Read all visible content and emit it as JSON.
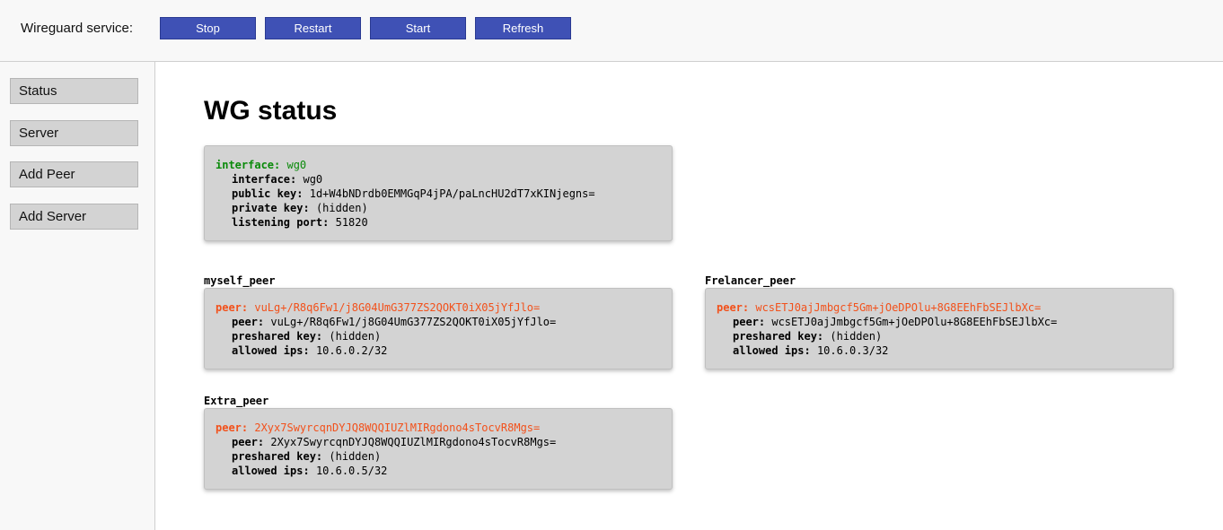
{
  "topbar": {
    "service_label": "Wireguard service:",
    "buttons": {
      "stop": "Stop",
      "restart": "Restart",
      "start": "Start",
      "refresh": "Refresh"
    }
  },
  "sidebar": {
    "items": [
      {
        "label": "Status"
      },
      {
        "label": "Server"
      },
      {
        "label": "Add Peer"
      },
      {
        "label": "Add Server"
      }
    ]
  },
  "main": {
    "title": "WG status",
    "interface": {
      "head_key": "interface:",
      "head_value": "wg0",
      "rows": [
        {
          "key": "interface:",
          "value": "wg0"
        },
        {
          "key": "public key:",
          "value": "1d+W4bNDrdb0EMMGqP4jPA/paLncHU2dT7xKINjegns="
        },
        {
          "key": "private key:",
          "value": "(hidden)"
        },
        {
          "key": "listening port:",
          "value": "51820"
        }
      ]
    },
    "peers": [
      {
        "name": "myself_peer",
        "head_key": "peer:",
        "head_value": "vuLg+/R8q6Fw1/j8G04UmG377ZS2QOKT0iX05jYfJlo=",
        "rows": [
          {
            "key": "peer:",
            "value": "vuLg+/R8q6Fw1/j8G04UmG377ZS2QOKT0iX05jYfJlo="
          },
          {
            "key": "preshared key:",
            "value": "(hidden)"
          },
          {
            "key": "allowed ips:",
            "value": "10.6.0.2/32"
          }
        ]
      },
      {
        "name": "Frelancer_peer",
        "head_key": "peer:",
        "head_value": "wcsETJ0ajJmbgcf5Gm+jOeDPOlu+8G8EEhFbSEJlbXc=",
        "rows": [
          {
            "key": "peer:",
            "value": "wcsETJ0ajJmbgcf5Gm+jOeDPOlu+8G8EEhFbSEJlbXc="
          },
          {
            "key": "preshared key:",
            "value": "(hidden)"
          },
          {
            "key": "allowed ips:",
            "value": "10.6.0.3/32"
          }
        ]
      },
      {
        "name": "Extra_peer",
        "head_key": "peer:",
        "head_value": "2Xyx7SwyrcqnDYJQ8WQQIUZlMIRgdono4sTocvR8Mgs=",
        "rows": [
          {
            "key": "peer:",
            "value": "2Xyx7SwyrcqnDYJQ8WQQIUZlMIRgdono4sTocvR8Mgs="
          },
          {
            "key": "preshared key:",
            "value": "(hidden)"
          },
          {
            "key": "allowed ips:",
            "value": "10.6.0.5/32"
          }
        ]
      }
    ]
  },
  "colors": {
    "button_bg": "#3f51b5",
    "interface_head": "#0a8a0a",
    "peer_head": "#f2511b",
    "card_bg": "#d3d3d3"
  }
}
